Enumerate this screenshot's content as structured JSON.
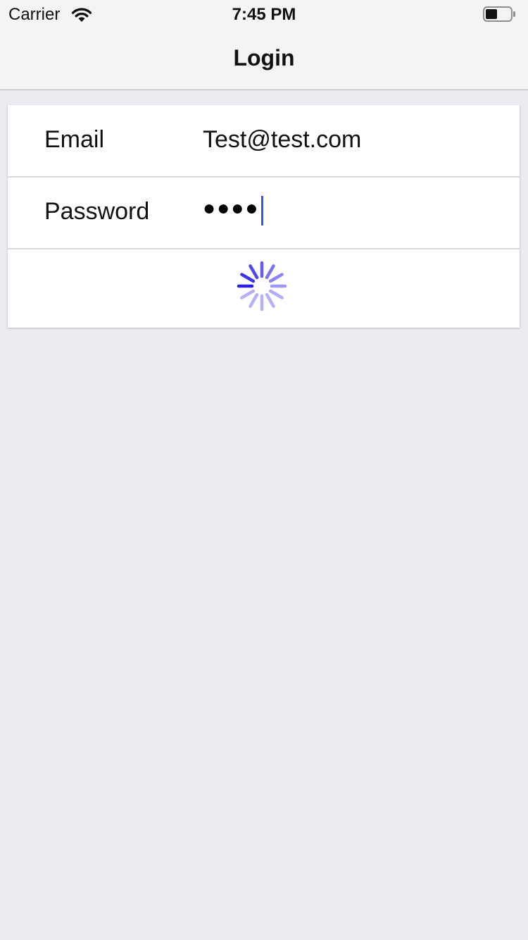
{
  "status_bar": {
    "carrier": "Carrier",
    "time": "7:45 PM",
    "wifi_icon": "wifi-icon",
    "battery_icon": "battery-icon"
  },
  "nav": {
    "title": "Login"
  },
  "form": {
    "email_label": "Email",
    "email_value": "Test@test.com",
    "password_label": "Password",
    "password_masked": "●●●●"
  },
  "spinner": {
    "icon": "activity-indicator-icon",
    "color": "#2b1fe8"
  }
}
